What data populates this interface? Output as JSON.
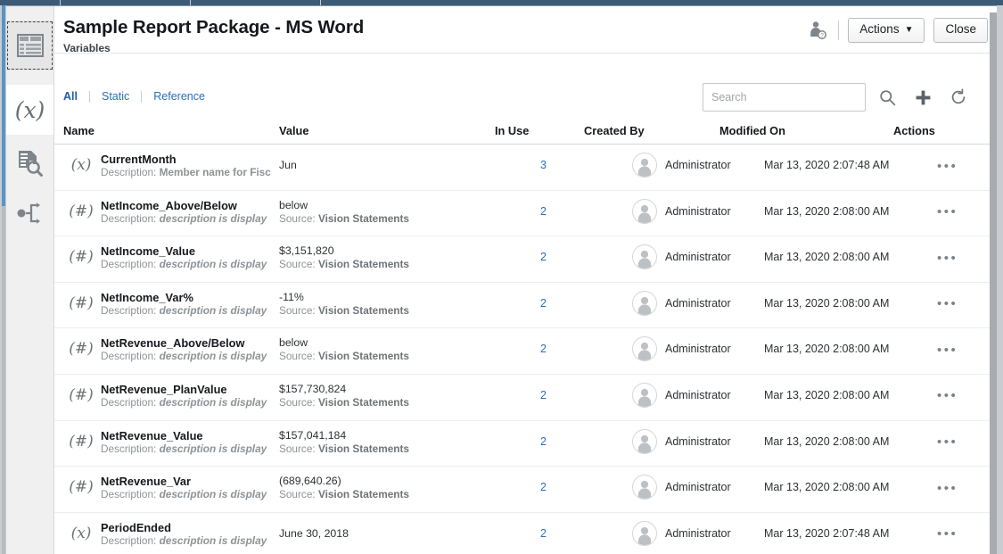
{
  "window": {
    "title": "Sample Report Package - MS Word",
    "subtitle": "Variables"
  },
  "header": {
    "user_icon": "user-permissions-icon",
    "actions_label": "Actions",
    "actions_caret": "▼",
    "close_label": "Close"
  },
  "filters": [
    {
      "label": "All",
      "selected": true
    },
    {
      "label": "Static",
      "selected": false
    },
    {
      "label": "Reference",
      "selected": false
    }
  ],
  "search": {
    "value": "",
    "placeholder": "Search",
    "icons": [
      "search-icon",
      "add-icon",
      "refresh-icon"
    ]
  },
  "sidebar": {
    "items": [
      {
        "name": "report-center-icon",
        "glyph": "grid",
        "state": "focused"
      },
      {
        "name": "variables-icon",
        "glyph": "(x)",
        "state": "active"
      },
      {
        "name": "review-document-icon",
        "glyph": "doc-search",
        "state": ""
      },
      {
        "name": "workflow-icon",
        "glyph": "branch",
        "state": ""
      }
    ]
  },
  "table": {
    "columns": [
      "Name",
      "Value",
      "In Use",
      "Created By",
      "Modified On",
      "Actions"
    ],
    "description_label": "Description:",
    "source_label": "Source:",
    "actions_glyph": "•••",
    "rows": [
      {
        "icon": "(x)",
        "name": "CurrentMonth",
        "description": "Member name for Fisc",
        "description_italic": false,
        "value": "Jun",
        "source": "",
        "in_use": "3",
        "created_by": "Administrator",
        "modified_on": "Mar 13, 2020 2:07:48 AM"
      },
      {
        "icon": "(#)",
        "name": "NetIncome_Above/Below",
        "description": "description is display",
        "description_italic": true,
        "value": "below",
        "source": "Vision Statements",
        "in_use": "2",
        "created_by": "Administrator",
        "modified_on": "Mar 13, 2020 2:08:00 AM"
      },
      {
        "icon": "(#)",
        "name": "NetIncome_Value",
        "description": "description is display",
        "description_italic": true,
        "value": "$3,151,820",
        "source": "Vision Statements",
        "in_use": "2",
        "created_by": "Administrator",
        "modified_on": "Mar 13, 2020 2:08:00 AM"
      },
      {
        "icon": "(#)",
        "name": "NetIncome_Var%",
        "description": "description is display",
        "description_italic": true,
        "value": "-11%",
        "source": "Vision Statements",
        "in_use": "2",
        "created_by": "Administrator",
        "modified_on": "Mar 13, 2020 2:08:00 AM"
      },
      {
        "icon": "(#)",
        "name": "NetRevenue_Above/Below",
        "description": "description is display",
        "description_italic": true,
        "value": "below",
        "source": "Vision Statements",
        "in_use": "2",
        "created_by": "Administrator",
        "modified_on": "Mar 13, 2020 2:08:00 AM"
      },
      {
        "icon": "(#)",
        "name": "NetRevenue_PlanValue",
        "description": "description is display",
        "description_italic": true,
        "value": "$157,730,824",
        "source": "Vision Statements",
        "in_use": "2",
        "created_by": "Administrator",
        "modified_on": "Mar 13, 2020 2:08:00 AM"
      },
      {
        "icon": "(#)",
        "name": "NetRevenue_Value",
        "description": "description is display",
        "description_italic": true,
        "value": "$157,041,184",
        "source": "Vision Statements",
        "in_use": "2",
        "created_by": "Administrator",
        "modified_on": "Mar 13, 2020 2:08:00 AM"
      },
      {
        "icon": "(#)",
        "name": "NetRevenue_Var",
        "description": "description is display",
        "description_italic": true,
        "value": "(689,640.26)",
        "source": "Vision Statements",
        "in_use": "2",
        "created_by": "Administrator",
        "modified_on": "Mar 13, 2020 2:08:00 AM"
      },
      {
        "icon": "(x)",
        "name": "PeriodEnded",
        "description": "description is display",
        "description_italic": true,
        "value": "June 30, 2018",
        "source": "",
        "in_use": "2",
        "created_by": "Administrator",
        "modified_on": "Mar 13, 2020 2:07:48 AM"
      }
    ]
  },
  "colors": {
    "link": "#2a6eb8",
    "accent": "#5b93c6",
    "title": "#15181c",
    "muted": "#8d9296"
  }
}
